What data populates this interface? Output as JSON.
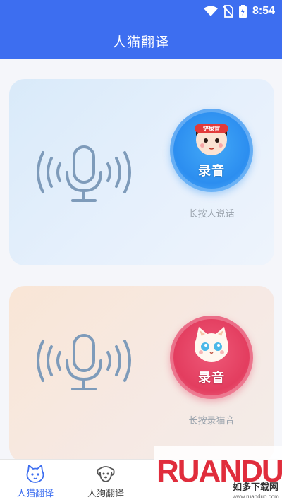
{
  "status_bar": {
    "time": "8:54"
  },
  "app_bar": {
    "title": "人猫翻译"
  },
  "human_card": {
    "badge_text": "铲屎官",
    "record_label": "录音",
    "hint": "长按人说话"
  },
  "cat_card": {
    "record_label": "录音",
    "hint": "长按录猫音"
  },
  "bottom_nav": {
    "tabs": [
      {
        "label": "人猫翻译",
        "icon": "cat-icon",
        "active": true
      },
      {
        "label": "人狗翻译",
        "icon": "dog-icon",
        "active": false
      }
    ]
  },
  "watermark": {
    "brand": "RUANDUO",
    "tagline": "如多下载网",
    "url": "www.ruanduo.com"
  },
  "colors": {
    "primary": "#3d6ef0",
    "human_button": "#2c8ef0",
    "cat_button": "#e33d5f"
  }
}
